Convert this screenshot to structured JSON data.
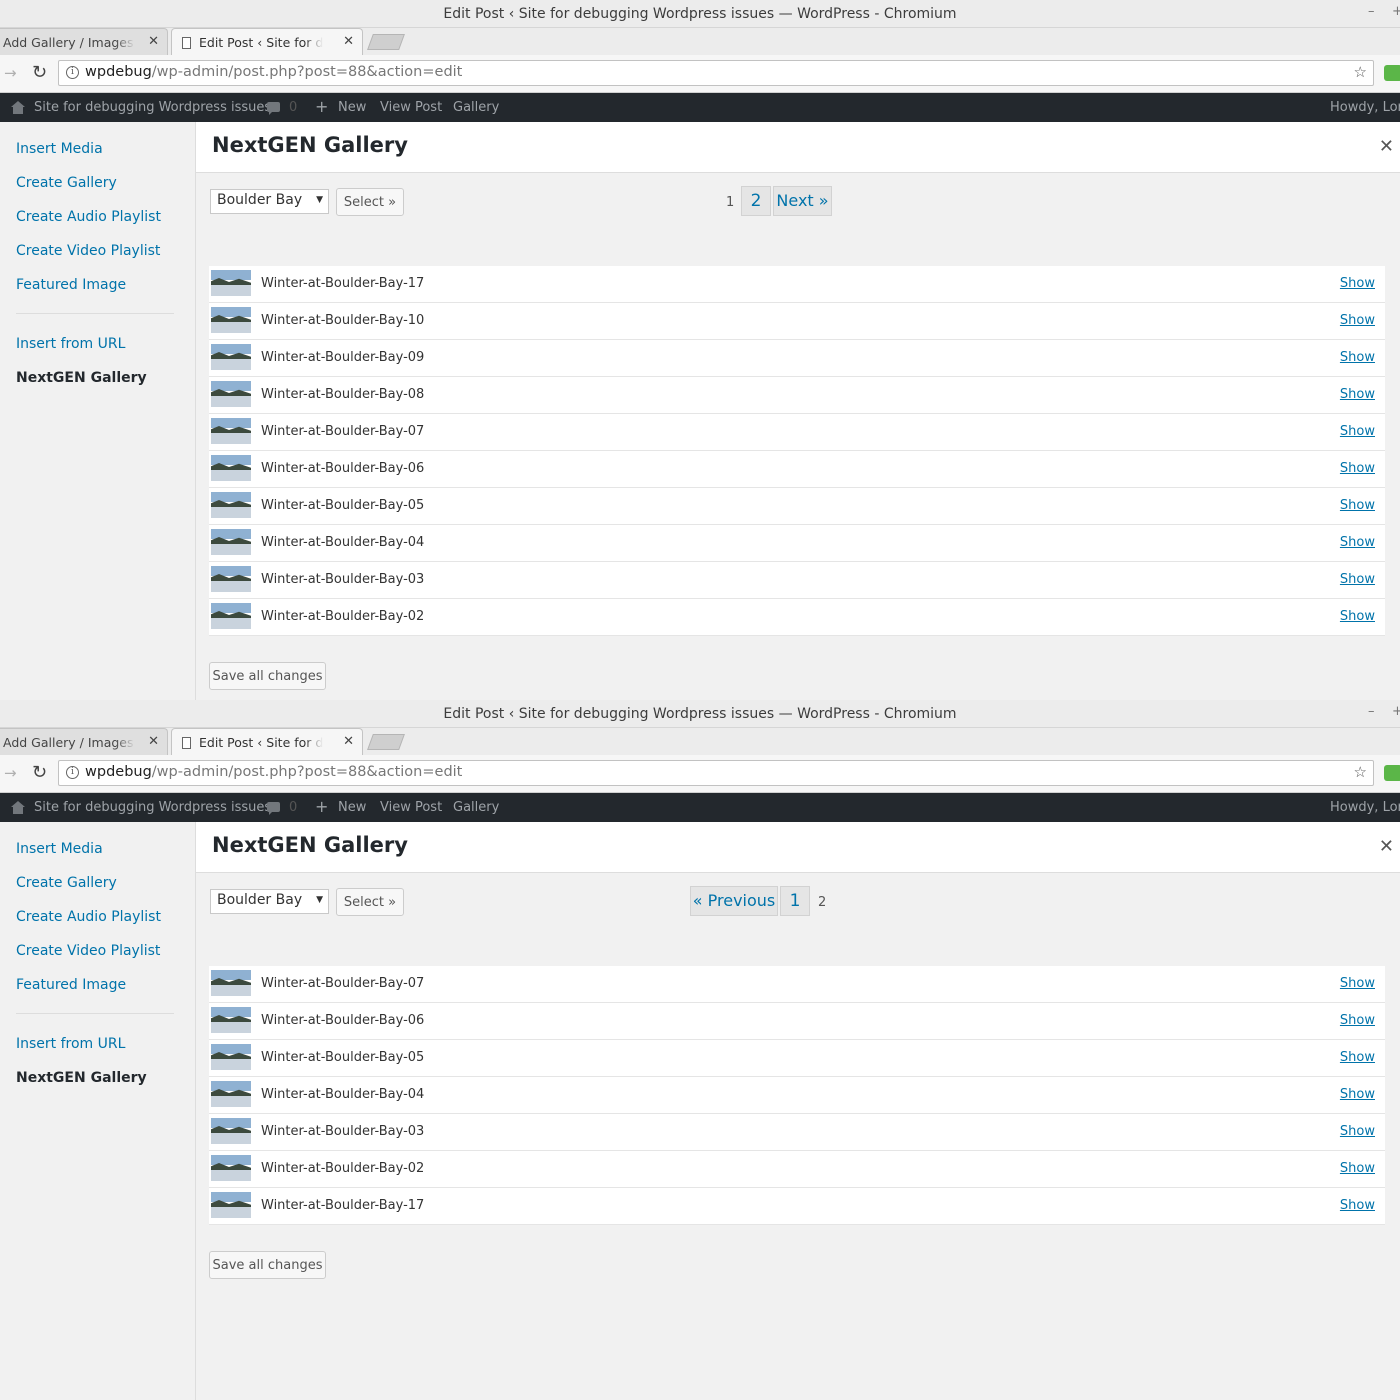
{
  "screens": [
    {
      "window_title": "Edit Post ‹ Site for debugging Wordpress issues — WordPress - Chromium",
      "tabs": [
        "Add Gallery / Images ‹ S",
        "Edit Post ‹ Site for debug"
      ],
      "omnibox": {
        "host": "wpdebug",
        "path": "/wp-admin/post.php?post=88&action=edit"
      },
      "adminbar": {
        "site": "Site for debugging Wordpress issues",
        "comments": "0",
        "new": "New",
        "view": "View Post",
        "gallery": "Gallery",
        "howdy": "Howdy, Lore"
      },
      "sidebar": {
        "items": [
          "Insert Media",
          "Create Gallery",
          "Create Audio Playlist",
          "Create Video Playlist",
          "Featured Image"
        ],
        "items2": [
          "Insert from URL",
          "NextGEN Gallery"
        ]
      },
      "frame_title": "NextGEN Gallery",
      "gallery_select": "Boulder Bay",
      "select_button": "Select »",
      "pager": {
        "current": "1",
        "other": "2",
        "next": "Next »"
      },
      "images": [
        "Winter-at-Boulder-Bay-17",
        "Winter-at-Boulder-Bay-10",
        "Winter-at-Boulder-Bay-09",
        "Winter-at-Boulder-Bay-08",
        "Winter-at-Boulder-Bay-07",
        "Winter-at-Boulder-Bay-06",
        "Winter-at-Boulder-Bay-05",
        "Winter-at-Boulder-Bay-04",
        "Winter-at-Boulder-Bay-03",
        "Winter-at-Boulder-Bay-02"
      ],
      "show_label": "Show",
      "save_label": "Save all changes"
    },
    {
      "window_title": "Edit Post ‹ Site for debugging Wordpress issues — WordPress - Chromium",
      "tabs": [
        "Add Gallery / Images ‹ S",
        "Edit Post ‹ Site for debug"
      ],
      "omnibox": {
        "host": "wpdebug",
        "path": "/wp-admin/post.php?post=88&action=edit"
      },
      "adminbar": {
        "site": "Site for debugging Wordpress issues",
        "comments": "0",
        "new": "New",
        "view": "View Post",
        "gallery": "Gallery",
        "howdy": "Howdy, Lore"
      },
      "sidebar": {
        "items": [
          "Insert Media",
          "Create Gallery",
          "Create Audio Playlist",
          "Create Video Playlist",
          "Featured Image"
        ],
        "items2": [
          "Insert from URL",
          "NextGEN Gallery"
        ]
      },
      "frame_title": "NextGEN Gallery",
      "gallery_select": "Boulder Bay",
      "select_button": "Select »",
      "pager": {
        "prev": "« Previous",
        "other": "1",
        "current": "2"
      },
      "images": [
        "Winter-at-Boulder-Bay-07",
        "Winter-at-Boulder-Bay-06",
        "Winter-at-Boulder-Bay-05",
        "Winter-at-Boulder-Bay-04",
        "Winter-at-Boulder-Bay-03",
        "Winter-at-Boulder-Bay-02",
        "Winter-at-Boulder-Bay-17"
      ],
      "show_label": "Show",
      "save_label": "Save all changes"
    }
  ],
  "colors": {
    "link": "#0073aa",
    "adminbar": "#23282d",
    "panel": "#f1f1f1"
  }
}
